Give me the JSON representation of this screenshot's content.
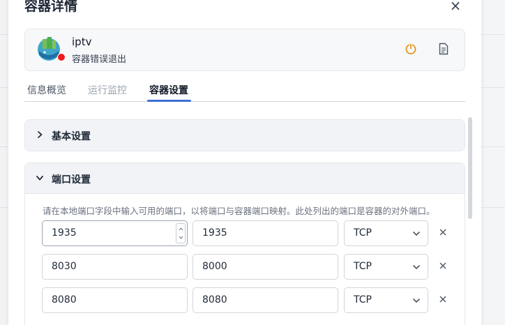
{
  "drawer": {
    "title": "容器详情"
  },
  "app": {
    "name": "iptv",
    "status": "容器错误退出"
  },
  "icons": {
    "close": "close-icon",
    "power": "power-icon",
    "log": "log-file-icon",
    "logo": "app-logo-icon"
  },
  "colors": {
    "accent": "#3b6fd8",
    "error": "#ef1b1b",
    "power": "#e3941d"
  },
  "tabs": [
    {
      "label": "信息概览"
    },
    {
      "label": "运行监控"
    },
    {
      "label": "容器设置"
    }
  ],
  "active_tab": "容器设置",
  "sections": {
    "basic": {
      "title": "基本设置",
      "expanded": false
    },
    "ports": {
      "title": "端口设置",
      "expanded": true,
      "hint": "请在本地端口字段中输入可用的端口，以将端口与容器端口映射。此处列出的端口是容器的对外端口。",
      "rows": [
        {
          "host": "1935",
          "container": "1935",
          "protocol": "TCP"
        },
        {
          "host": "8030",
          "container": "8000",
          "protocol": "TCP"
        },
        {
          "host": "8080",
          "container": "8080",
          "protocol": "TCP"
        }
      ]
    }
  }
}
